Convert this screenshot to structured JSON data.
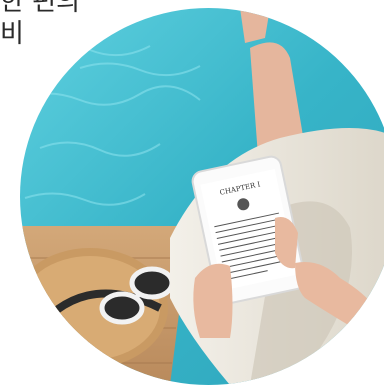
{
  "caption": {
    "line1": "한 편의",
    "line2": "비"
  },
  "photo": {
    "subject": "hands-holding-phone-ebook-by-pool",
    "colors": {
      "pool": "#3fbcd0",
      "deck": "#c79a6a",
      "dress": "#ebe7de",
      "skin": "#e6b8a0",
      "hat": "#d2a572"
    }
  },
  "ebook": {
    "chapter": "CHAPTER I"
  }
}
